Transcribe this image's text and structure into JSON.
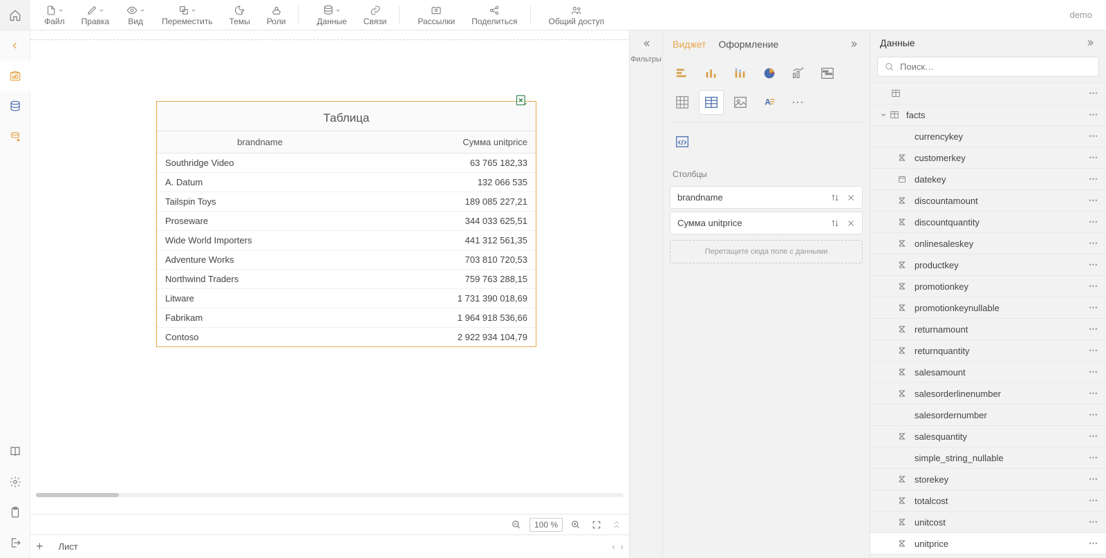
{
  "topbar": {
    "menus": [
      {
        "label": "Файл",
        "icon": "file"
      },
      {
        "label": "Правка",
        "icon": "pencil"
      },
      {
        "label": "Вид",
        "icon": "eye"
      },
      {
        "label": "Переместить",
        "icon": "move"
      },
      {
        "label": "Темы",
        "icon": "theme"
      },
      {
        "label": "Роли",
        "icon": "roles"
      }
    ],
    "menus2": [
      {
        "label": "Данные",
        "icon": "db"
      },
      {
        "label": "Связи",
        "icon": "link"
      }
    ],
    "menus3": [
      {
        "label": "Рассылки",
        "icon": "mail"
      },
      {
        "label": "Поделиться",
        "icon": "share"
      }
    ],
    "menus4": [
      {
        "label": "Общий доступ",
        "icon": "people"
      }
    ],
    "user": "demo"
  },
  "filters": {
    "label": "Фильтры"
  },
  "widget_panel": {
    "tabs": [
      "Виджет",
      "Оформление"
    ],
    "active_tab": 0,
    "columns_label": "Столбцы",
    "columns": [
      "brandname",
      "Сумма unitprice"
    ],
    "drop_hint": "Перетащите сюда поле с данными"
  },
  "data_panel": {
    "title": "Данные",
    "search_placeholder": "Поиск…",
    "table_name": "facts",
    "fields": [
      {
        "name": "currencykey",
        "icon": "text"
      },
      {
        "name": "customerkey",
        "icon": "sigma"
      },
      {
        "name": "datekey",
        "icon": "date"
      },
      {
        "name": "discountamount",
        "icon": "sigma"
      },
      {
        "name": "discountquantity",
        "icon": "sigma"
      },
      {
        "name": "onlinesaleskey",
        "icon": "sigma"
      },
      {
        "name": "productkey",
        "icon": "sigma"
      },
      {
        "name": "promotionkey",
        "icon": "sigma"
      },
      {
        "name": "promotionkeynullable",
        "icon": "sigma"
      },
      {
        "name": "returnamount",
        "icon": "sigma"
      },
      {
        "name": "returnquantity",
        "icon": "sigma"
      },
      {
        "name": "salesamount",
        "icon": "sigma"
      },
      {
        "name": "salesorderlinenumber",
        "icon": "sigma"
      },
      {
        "name": "salesordernumber",
        "icon": "text"
      },
      {
        "name": "salesquantity",
        "icon": "sigma"
      },
      {
        "name": "simple_string_nullable",
        "icon": "text"
      },
      {
        "name": "storekey",
        "icon": "sigma"
      },
      {
        "name": "totalcost",
        "icon": "sigma"
      },
      {
        "name": "unitcost",
        "icon": "sigma"
      },
      {
        "name": "unitprice",
        "icon": "sigma",
        "selected": true
      }
    ]
  },
  "table": {
    "title": "Таблица",
    "headers": [
      "brandname",
      "Сумма unitprice"
    ],
    "rows": [
      [
        "Southridge Video",
        "63 765 182,33"
      ],
      [
        "A. Datum",
        "132 066 535"
      ],
      [
        "Tailspin Toys",
        "189 085 227,21"
      ],
      [
        "Proseware",
        "344 033 625,51"
      ],
      [
        "Wide World Importers",
        "441 312 561,35"
      ],
      [
        "Adventure Works",
        "703 810 720,53"
      ],
      [
        "Northwind Traders",
        "759 763 288,15"
      ],
      [
        "Litware",
        "1 731 390 018,69"
      ],
      [
        "Fabrikam",
        "1 964 918 536,66"
      ],
      [
        "Contoso",
        "2 922 934 104,79"
      ]
    ]
  },
  "statusbar": {
    "zoom": "100 %"
  },
  "sheetbar": {
    "sheet": "Лист"
  }
}
